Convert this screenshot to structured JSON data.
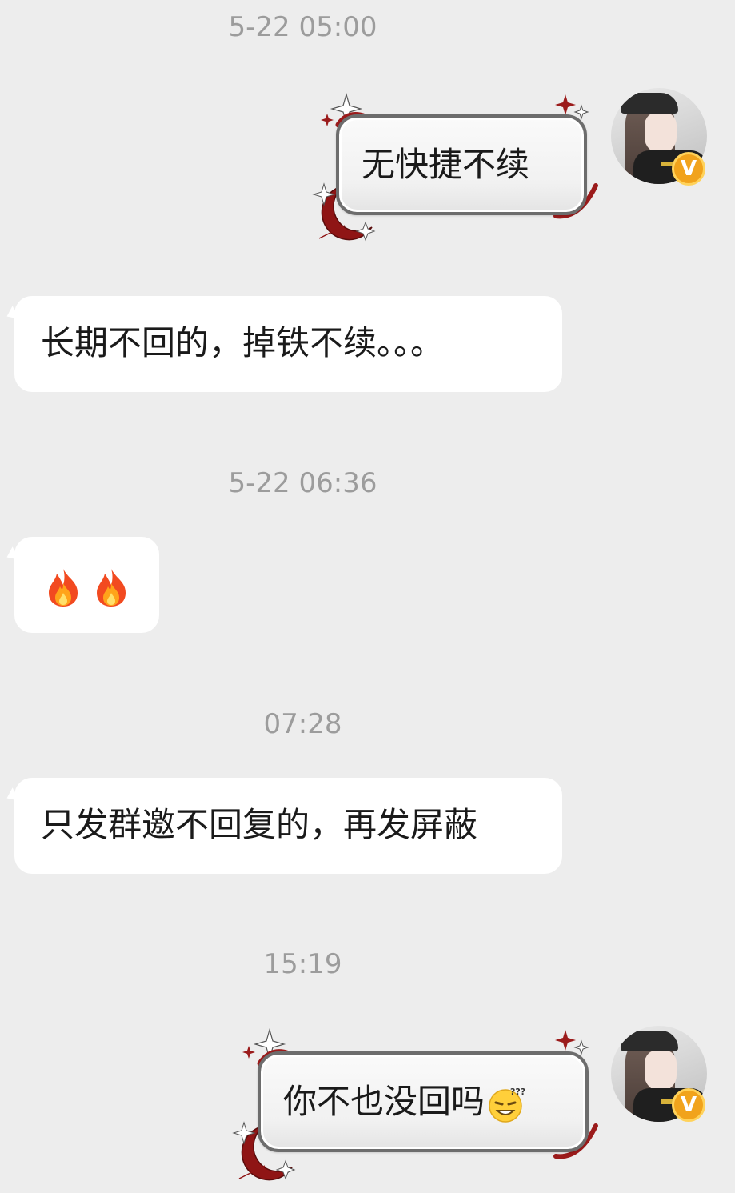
{
  "messages": [
    {
      "type": "timestamp",
      "text": "5-22 05:00"
    },
    {
      "type": "outgoing",
      "text": "无快捷不续",
      "sender_avatar": "avatar-girl-cap",
      "badge": "V"
    },
    {
      "type": "incoming",
      "text": "长期不回的，掉铁不续。。。"
    },
    {
      "type": "timestamp",
      "text": "5-22 06:36"
    },
    {
      "type": "incoming",
      "emoji": [
        "fire-emoji",
        "fire-emoji"
      ]
    },
    {
      "type": "timestamp",
      "text": "07:28"
    },
    {
      "type": "incoming",
      "text": "只发群邀不回复的，再发屏蔽"
    },
    {
      "type": "timestamp",
      "text": "15:19"
    },
    {
      "type": "outgoing",
      "text": "你不也没回吗",
      "emoji": "confused-smile-emoji",
      "sender_avatar": "avatar-girl-cap",
      "badge": "V"
    }
  ],
  "colors": {
    "background": "#ededed",
    "incoming_bubble": "#ffffff",
    "outgoing_bubble_border": "#6d6d6d",
    "timestamp_text": "#9c9c9c",
    "decoration_red": "#9b1b1b",
    "badge": "#f1a31c"
  }
}
